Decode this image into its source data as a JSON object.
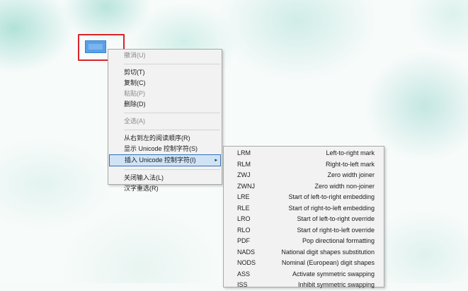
{
  "context_menu": {
    "items": [
      {
        "label": "撤消(U)",
        "disabled": true
      },
      {
        "separator": true
      },
      {
        "label": "剪切(T)",
        "disabled": false
      },
      {
        "label": "复制(C)",
        "disabled": false
      },
      {
        "label": "粘贴(P)",
        "disabled": true
      },
      {
        "label": "删除(D)",
        "disabled": false
      },
      {
        "separator": true
      },
      {
        "label": "全选(A)",
        "disabled": true
      },
      {
        "separator": true
      },
      {
        "label": "从右到左的阅读顺序(R)",
        "disabled": false
      },
      {
        "label": "显示 Unicode 控制字符(S)",
        "disabled": false
      },
      {
        "label": "插入 Unicode 控制字符(I)",
        "disabled": false,
        "active": true,
        "submenu_arrow": "▸"
      },
      {
        "separator": true
      },
      {
        "label": "关闭输入法(L)",
        "disabled": false
      },
      {
        "label": "汉字重选(R)",
        "disabled": false
      }
    ]
  },
  "unicode_submenu": {
    "items": [
      {
        "code": "LRM",
        "desc": "Left-to-right mark"
      },
      {
        "code": "RLM",
        "desc": "Right-to-left mark"
      },
      {
        "code": "ZWJ",
        "desc": "Zero width joiner"
      },
      {
        "code": "ZWNJ",
        "desc": "Zero width non-joiner"
      },
      {
        "code": "LRE",
        "desc": "Start of left-to-right embedding"
      },
      {
        "code": "RLE",
        "desc": "Start of right-to-left embedding"
      },
      {
        "code": "LRO",
        "desc": "Start of left-to-right override"
      },
      {
        "code": "RLO",
        "desc": "Start of right-to-left override"
      },
      {
        "code": "PDF",
        "desc": "Pop directional formatting"
      },
      {
        "code": "NADS",
        "desc": "National digit shapes substitution"
      },
      {
        "code": "NODS",
        "desc": "Nominal (European) digit shapes"
      },
      {
        "code": "ASS",
        "desc": "Activate symmetric swapping"
      },
      {
        "code": "ISS",
        "desc": "Inhibit symmetric swapping"
      }
    ]
  },
  "colors": {
    "highlight_border": "#d9252a",
    "selection": "#5aa0e6",
    "active_item_bg": "#cfe3f7",
    "active_item_border": "#2f6fb4"
  }
}
